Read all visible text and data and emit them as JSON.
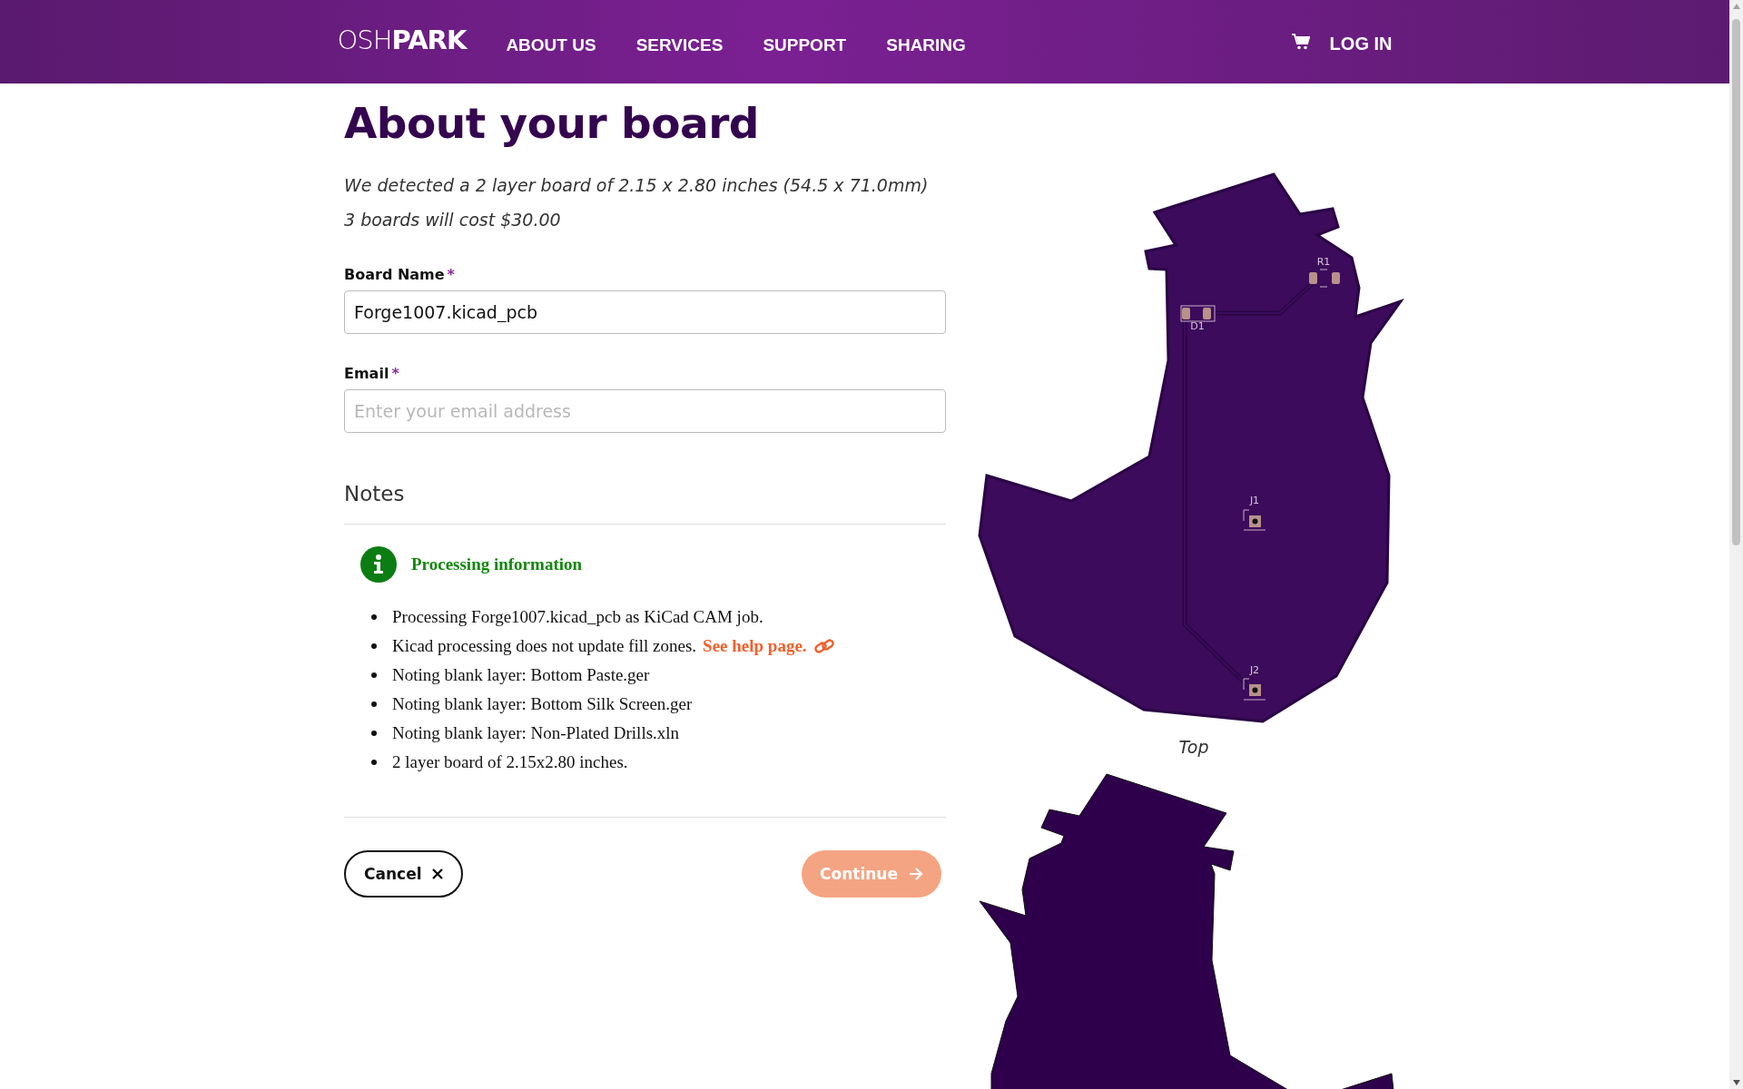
{
  "nav": {
    "logo_light": "OSH",
    "logo_bold": "PARK",
    "items": [
      "ABOUT US",
      "SERVICES",
      "SUPPORT",
      "SHARING"
    ],
    "login": "LOG IN"
  },
  "title": "About your board",
  "summary": [
    "We detected a 2 layer board of 2.15 x 2.80 inches (54.5 x 71.0mm)",
    "3 boards will cost $30.00"
  ],
  "fields": [
    {
      "label": "Board Name",
      "required_mark": "*",
      "value": "Forge1007.kicad_pcb"
    },
    {
      "label": "Email",
      "required_mark": "*",
      "placeholder": "Enter your email address"
    }
  ],
  "notes": {
    "heading": "Notes",
    "info_title": "Processing information",
    "items": [
      {
        "text": "Processing Forge1007.kicad_pcb as KiCad CAM job."
      },
      {
        "text": "Kicad processing does not update fill zones.",
        "link": "See help page."
      },
      {
        "text": "Noting blank layer: Bottom Paste.ger"
      },
      {
        "text": "Noting blank layer: Bottom Silk Screen.ger"
      },
      {
        "text": "Noting blank layer: Non-Plated Drills.xln"
      },
      {
        "text": "2 layer board of 2.15x2.80 inches."
      }
    ]
  },
  "buttons": {
    "cancel": {
      "label": "Cancel"
    },
    "continue": {
      "label": "Continue",
      "disabled": true
    }
  },
  "board_preview": {
    "caption": "Top",
    "silk_labels": [
      "R1",
      "D1",
      "J1",
      "J2"
    ]
  }
}
